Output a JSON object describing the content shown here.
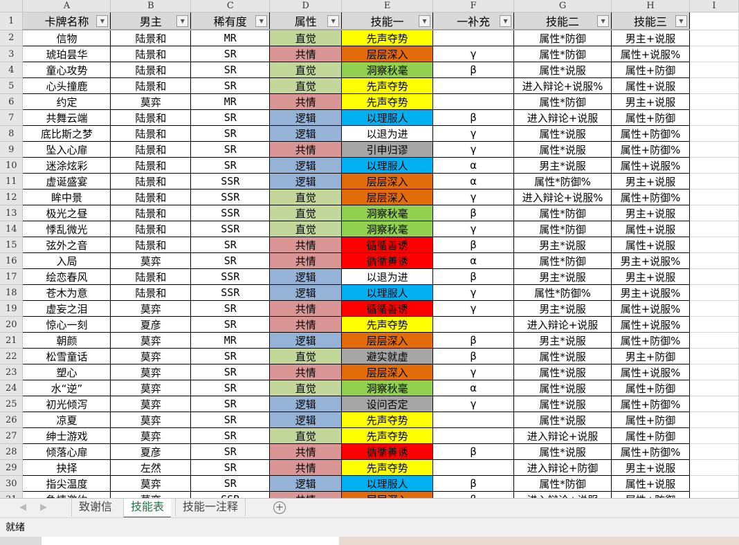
{
  "columns": [
    "A",
    "B",
    "C",
    "D",
    "E",
    "F",
    "G",
    "H",
    "I"
  ],
  "headers": [
    "卡牌名称",
    "男主",
    "稀有度",
    "属性",
    "技能一",
    "一补充",
    "技能二",
    "技能三"
  ],
  "attr_colors": {
    "直觉": "#c4d79b",
    "共情": "#da9694",
    "逻辑": "#95b3d7"
  },
  "skill_colors": {
    "先声夺势": "#ffff00",
    "层层深入": "#e26b0a",
    "洞察秋毫": "#92d050",
    "以理服人": "#00b0f0",
    "以退为进": "#ffffff",
    "引申归谬": "#a6a6a6",
    "循循善诱": "#ff0000",
    "避实就虚": "#a6a6a6",
    "设问否定": "#a6a6a6"
  },
  "rows": [
    [
      "信物",
      "陆景和",
      "MR",
      "直觉",
      "先声夺势",
      "",
      "属性*防御",
      "男主+说服"
    ],
    [
      "琥珀昙华",
      "陆景和",
      "SR",
      "共情",
      "层层深入",
      "γ",
      "属性*防御",
      "属性+说服%"
    ],
    [
      "童心攻势",
      "陆景和",
      "SR",
      "直觉",
      "洞察秋毫",
      "β",
      "属性*说服",
      "属性+防御"
    ],
    [
      "心头撞鹿",
      "陆景和",
      "SR",
      "直觉",
      "先声夺势",
      "",
      "进入辩论+说服%",
      "属性+说服"
    ],
    [
      "约定",
      "莫弈",
      "MR",
      "共情",
      "先声夺势",
      "",
      "属性*防御",
      "男主+说服"
    ],
    [
      "共舞云端",
      "陆景和",
      "SR",
      "逻辑",
      "以理服人",
      "β",
      "进入辩论+说服",
      "属性+防御"
    ],
    [
      "底比斯之梦",
      "陆景和",
      "SR",
      "逻辑",
      "以退为进",
      "γ",
      "属性*说服",
      "属性+防御%"
    ],
    [
      "坠入心扉",
      "陆景和",
      "SR",
      "共情",
      "引申归谬",
      "γ",
      "属性*说服",
      "属性+防御%"
    ],
    [
      "迷涂炫彩",
      "陆景和",
      "SR",
      "逻辑",
      "以理服人",
      "α",
      "男主*说服",
      "属性+说服%"
    ],
    [
      "虚诞盛宴",
      "陆景和",
      "SSR",
      "逻辑",
      "层层深入",
      "α",
      "属性*防御%",
      "男主+说服"
    ],
    [
      "眸中景",
      "陆景和",
      "SSR",
      "直觉",
      "层层深入",
      "γ",
      "进入辩论+说服%",
      "属性+防御%"
    ],
    [
      "极光之昼",
      "陆景和",
      "SSR",
      "直觉",
      "洞察秋毫",
      "β",
      "属性*防御",
      "男主+说服"
    ],
    [
      "悸乱微光",
      "陆景和",
      "SSR",
      "直觉",
      "洞察秋毫",
      "γ",
      "属性*防御",
      "属性+说服"
    ],
    [
      "弦外之音",
      "陆景和",
      "SR",
      "共情",
      "循循善诱",
      "β",
      "男主*说服",
      "属性+说服"
    ],
    [
      "入局",
      "莫弈",
      "SR",
      "共情",
      "循循善诱",
      "α",
      "属性*防御",
      "男主+说服%"
    ],
    [
      "绘恋春风",
      "陆景和",
      "SSR",
      "逻辑",
      "以退为进",
      "β",
      "男主*说服",
      "男主+说服"
    ],
    [
      "苍木为意",
      "陆景和",
      "SSR",
      "逻辑",
      "以理服人",
      "γ",
      "属性*防御%",
      "男主+说服%"
    ],
    [
      "虚妄之泪",
      "莫弈",
      "SR",
      "共情",
      "循循善诱",
      "γ",
      "男主*说服",
      "属性+说服%"
    ],
    [
      "惊心一刻",
      "夏彦",
      "SR",
      "共情",
      "先声夺势",
      "",
      "进入辩论+说服",
      "属性+说服%"
    ],
    [
      "朝颜",
      "莫弈",
      "MR",
      "逻辑",
      "层层深入",
      "β",
      "男主*说服",
      "属性+防御%"
    ],
    [
      "松雪童话",
      "莫弈",
      "SR",
      "直觉",
      "避实就虚",
      "β",
      "属性*说服",
      "男主+防御"
    ],
    [
      "塑心",
      "莫弈",
      "SR",
      "共情",
      "层层深入",
      "γ",
      "属性*说服",
      "属性+说服%"
    ],
    [
      "水“逆”",
      "莫弈",
      "SR",
      "直觉",
      "洞察秋毫",
      "α",
      "属性*说服",
      "属性+防御"
    ],
    [
      "初光倾泻",
      "莫弈",
      "SR",
      "逻辑",
      "设问否定",
      "γ",
      "属性*说服",
      "属性+防御%"
    ],
    [
      "凉夏",
      "莫弈",
      "SR",
      "逻辑",
      "先声夺势",
      "",
      "属性*说服",
      "属性+防御"
    ],
    [
      "绅士游戏",
      "莫弈",
      "SR",
      "直觉",
      "先声夺势",
      "",
      "进入辩论+说服",
      "属性+防御"
    ],
    [
      "倾落心扉",
      "夏彦",
      "SR",
      "共情",
      "循循善诱",
      "β",
      "属性*说服",
      "属性+防御%"
    ],
    [
      "抉择",
      "左然",
      "SR",
      "共情",
      "先声夺势",
      "",
      "进入辩论+防御",
      "男主+说服"
    ],
    [
      "指尖温度",
      "莫弈",
      "SR",
      "逻辑",
      "以理服人",
      "β",
      "属性*防御",
      "属性+说服"
    ],
    [
      "急情邀约",
      "莫弈",
      "SSR",
      "共情",
      "层层深入",
      "β",
      "进入辩论+说服",
      "属性+防御"
    ]
  ],
  "sheet_tabs": [
    "致谢信",
    "技能表",
    "技能一注释"
  ],
  "active_tab": "技能表",
  "add_sheet": "+",
  "status": "就绪"
}
